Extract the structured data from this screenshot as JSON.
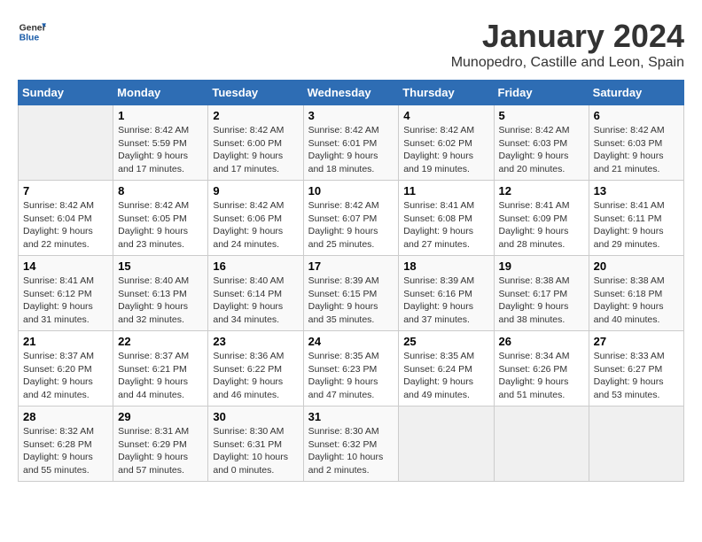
{
  "logo": {
    "line1": "General",
    "line2": "Blue"
  },
  "title": "January 2024",
  "subtitle": "Munopedro, Castille and Leon, Spain",
  "weekdays": [
    "Sunday",
    "Monday",
    "Tuesday",
    "Wednesday",
    "Thursday",
    "Friday",
    "Saturday"
  ],
  "weeks": [
    [
      {
        "num": "",
        "empty": true
      },
      {
        "num": "1",
        "sunrise": "Sunrise: 8:42 AM",
        "sunset": "Sunset: 5:59 PM",
        "daylight": "Daylight: 9 hours and 17 minutes."
      },
      {
        "num": "2",
        "sunrise": "Sunrise: 8:42 AM",
        "sunset": "Sunset: 6:00 PM",
        "daylight": "Daylight: 9 hours and 17 minutes."
      },
      {
        "num": "3",
        "sunrise": "Sunrise: 8:42 AM",
        "sunset": "Sunset: 6:01 PM",
        "daylight": "Daylight: 9 hours and 18 minutes."
      },
      {
        "num": "4",
        "sunrise": "Sunrise: 8:42 AM",
        "sunset": "Sunset: 6:02 PM",
        "daylight": "Daylight: 9 hours and 19 minutes."
      },
      {
        "num": "5",
        "sunrise": "Sunrise: 8:42 AM",
        "sunset": "Sunset: 6:03 PM",
        "daylight": "Daylight: 9 hours and 20 minutes."
      },
      {
        "num": "6",
        "sunrise": "Sunrise: 8:42 AM",
        "sunset": "Sunset: 6:03 PM",
        "daylight": "Daylight: 9 hours and 21 minutes."
      }
    ],
    [
      {
        "num": "7",
        "sunrise": "Sunrise: 8:42 AM",
        "sunset": "Sunset: 6:04 PM",
        "daylight": "Daylight: 9 hours and 22 minutes."
      },
      {
        "num": "8",
        "sunrise": "Sunrise: 8:42 AM",
        "sunset": "Sunset: 6:05 PM",
        "daylight": "Daylight: 9 hours and 23 minutes."
      },
      {
        "num": "9",
        "sunrise": "Sunrise: 8:42 AM",
        "sunset": "Sunset: 6:06 PM",
        "daylight": "Daylight: 9 hours and 24 minutes."
      },
      {
        "num": "10",
        "sunrise": "Sunrise: 8:42 AM",
        "sunset": "Sunset: 6:07 PM",
        "daylight": "Daylight: 9 hours and 25 minutes."
      },
      {
        "num": "11",
        "sunrise": "Sunrise: 8:41 AM",
        "sunset": "Sunset: 6:08 PM",
        "daylight": "Daylight: 9 hours and 27 minutes."
      },
      {
        "num": "12",
        "sunrise": "Sunrise: 8:41 AM",
        "sunset": "Sunset: 6:09 PM",
        "daylight": "Daylight: 9 hours and 28 minutes."
      },
      {
        "num": "13",
        "sunrise": "Sunrise: 8:41 AM",
        "sunset": "Sunset: 6:11 PM",
        "daylight": "Daylight: 9 hours and 29 minutes."
      }
    ],
    [
      {
        "num": "14",
        "sunrise": "Sunrise: 8:41 AM",
        "sunset": "Sunset: 6:12 PM",
        "daylight": "Daylight: 9 hours and 31 minutes."
      },
      {
        "num": "15",
        "sunrise": "Sunrise: 8:40 AM",
        "sunset": "Sunset: 6:13 PM",
        "daylight": "Daylight: 9 hours and 32 minutes."
      },
      {
        "num": "16",
        "sunrise": "Sunrise: 8:40 AM",
        "sunset": "Sunset: 6:14 PM",
        "daylight": "Daylight: 9 hours and 34 minutes."
      },
      {
        "num": "17",
        "sunrise": "Sunrise: 8:39 AM",
        "sunset": "Sunset: 6:15 PM",
        "daylight": "Daylight: 9 hours and 35 minutes."
      },
      {
        "num": "18",
        "sunrise": "Sunrise: 8:39 AM",
        "sunset": "Sunset: 6:16 PM",
        "daylight": "Daylight: 9 hours and 37 minutes."
      },
      {
        "num": "19",
        "sunrise": "Sunrise: 8:38 AM",
        "sunset": "Sunset: 6:17 PM",
        "daylight": "Daylight: 9 hours and 38 minutes."
      },
      {
        "num": "20",
        "sunrise": "Sunrise: 8:38 AM",
        "sunset": "Sunset: 6:18 PM",
        "daylight": "Daylight: 9 hours and 40 minutes."
      }
    ],
    [
      {
        "num": "21",
        "sunrise": "Sunrise: 8:37 AM",
        "sunset": "Sunset: 6:20 PM",
        "daylight": "Daylight: 9 hours and 42 minutes."
      },
      {
        "num": "22",
        "sunrise": "Sunrise: 8:37 AM",
        "sunset": "Sunset: 6:21 PM",
        "daylight": "Daylight: 9 hours and 44 minutes."
      },
      {
        "num": "23",
        "sunrise": "Sunrise: 8:36 AM",
        "sunset": "Sunset: 6:22 PM",
        "daylight": "Daylight: 9 hours and 46 minutes."
      },
      {
        "num": "24",
        "sunrise": "Sunrise: 8:35 AM",
        "sunset": "Sunset: 6:23 PM",
        "daylight": "Daylight: 9 hours and 47 minutes."
      },
      {
        "num": "25",
        "sunrise": "Sunrise: 8:35 AM",
        "sunset": "Sunset: 6:24 PM",
        "daylight": "Daylight: 9 hours and 49 minutes."
      },
      {
        "num": "26",
        "sunrise": "Sunrise: 8:34 AM",
        "sunset": "Sunset: 6:26 PM",
        "daylight": "Daylight: 9 hours and 51 minutes."
      },
      {
        "num": "27",
        "sunrise": "Sunrise: 8:33 AM",
        "sunset": "Sunset: 6:27 PM",
        "daylight": "Daylight: 9 hours and 53 minutes."
      }
    ],
    [
      {
        "num": "28",
        "sunrise": "Sunrise: 8:32 AM",
        "sunset": "Sunset: 6:28 PM",
        "daylight": "Daylight: 9 hours and 55 minutes."
      },
      {
        "num": "29",
        "sunrise": "Sunrise: 8:31 AM",
        "sunset": "Sunset: 6:29 PM",
        "daylight": "Daylight: 9 hours and 57 minutes."
      },
      {
        "num": "30",
        "sunrise": "Sunrise: 8:30 AM",
        "sunset": "Sunset: 6:31 PM",
        "daylight": "Daylight: 10 hours and 0 minutes."
      },
      {
        "num": "31",
        "sunrise": "Sunrise: 8:30 AM",
        "sunset": "Sunset: 6:32 PM",
        "daylight": "Daylight: 10 hours and 2 minutes."
      },
      {
        "num": "",
        "empty": true
      },
      {
        "num": "",
        "empty": true
      },
      {
        "num": "",
        "empty": true
      }
    ]
  ]
}
